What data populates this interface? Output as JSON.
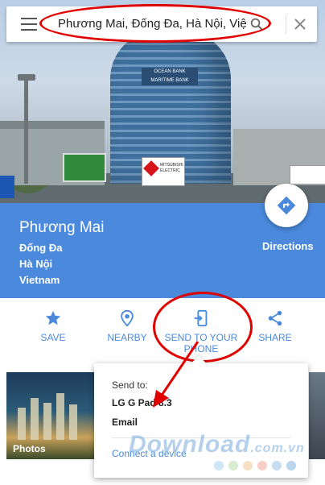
{
  "search": {
    "query": "Phương Mai, Đống Đa, Hà Nội, Việt Nam"
  },
  "hero": {
    "building_sign_1": "OCEAN BANK",
    "building_sign_2": "MARITIME BANK",
    "billboard_text": "MITSUBISHI ELECTRIC"
  },
  "place": {
    "name": "Phương Mai",
    "address_lines": [
      "Đống Đa",
      "Hà Nội",
      "Vietnam"
    ],
    "directions_label": "Directions"
  },
  "actions": {
    "save": "SAVE",
    "nearby": "NEARBY",
    "send_line1": "SEND TO YOUR",
    "send_line2": "PHONE",
    "share": "SHARE"
  },
  "photos": {
    "label": "Photos"
  },
  "popup": {
    "send_to": "Send to:",
    "device": "LG G Pad 8.3",
    "email": "Email",
    "connect": "Connect a device"
  },
  "watermark": {
    "text": "Download",
    "suffix": ".com.vn"
  },
  "colors": {
    "accent": "#4a89dc",
    "annotation": "#e00000",
    "dots": [
      "#cfe6f7",
      "#d8ecd2",
      "#f7e1c6",
      "#f7cfc7",
      "#c8ddf2",
      "#bcd5ee"
    ]
  }
}
